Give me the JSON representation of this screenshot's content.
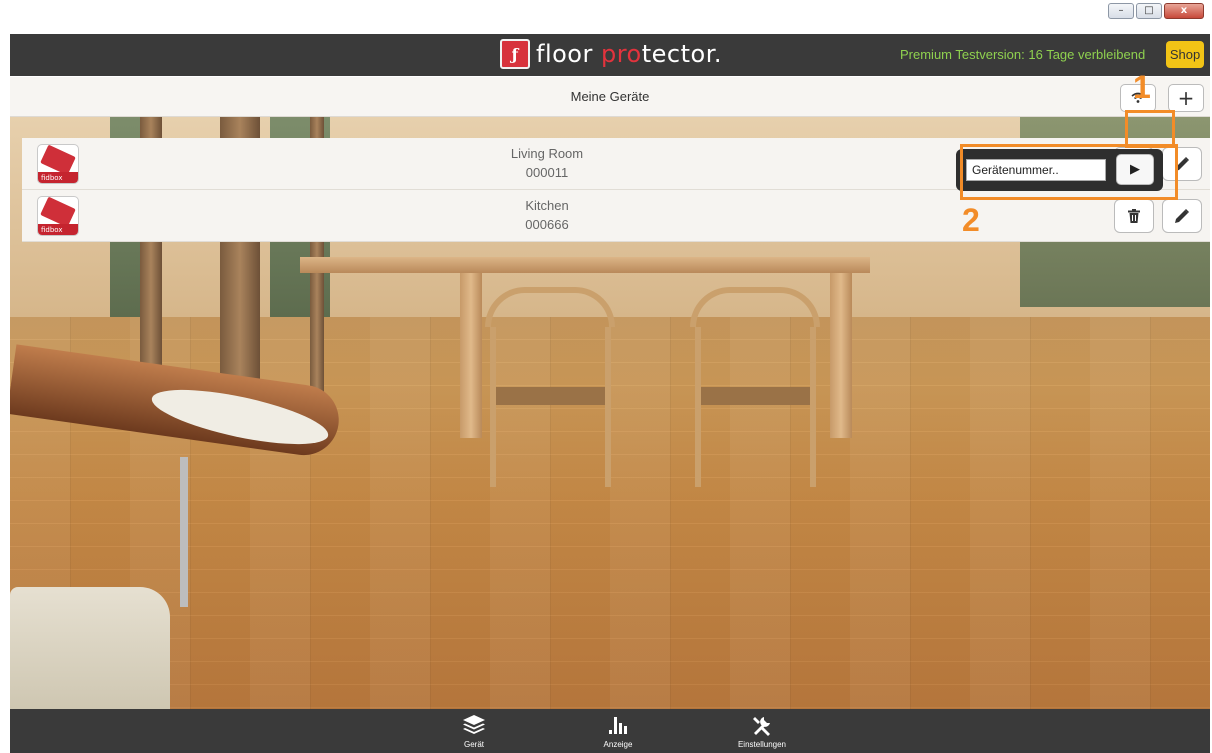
{
  "window": {
    "minimize_label": "–",
    "maximize_label": "□",
    "close_label": "x"
  },
  "header": {
    "logo_mark": "ƒ",
    "logo_text_floor": "floor ",
    "logo_text_pro": "pro",
    "logo_text_tector": "tector.",
    "premium_text": "Premium Testversion: 16 Tage verbleibend",
    "shop_label": "Shop"
  },
  "subheader": {
    "title": "Meine Geräte",
    "add_label": "+"
  },
  "devices": [
    {
      "name": "Living Room",
      "id": "000011",
      "icon_tag": "fidbox"
    },
    {
      "name": "Kitchen",
      "id": "000666",
      "icon_tag": "fidbox"
    }
  ],
  "popup": {
    "placeholder": "Gerätenummer..",
    "submit_label": "▶"
  },
  "annotations": {
    "one": "1",
    "two": "2"
  },
  "bottom_nav": {
    "items": [
      {
        "label": "Gerät",
        "icon": "layers-icon"
      },
      {
        "label": "Anzeige",
        "icon": "bar-chart-icon"
      },
      {
        "label": "Einstellungen",
        "icon": "tools-icon"
      }
    ]
  },
  "colors": {
    "topbar": "#3a3a3a",
    "premium_text": "#8fd14f",
    "shop_button": "#f2c416",
    "brand_red": "#e2333d",
    "annotation": "#f28c28"
  }
}
